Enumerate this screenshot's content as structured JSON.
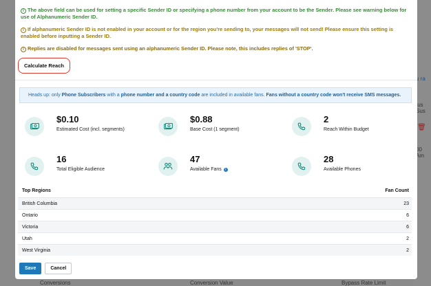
{
  "notes": [
    {
      "text": "The above field can be used for setting a specific Sender ID or specifying a phone number from your account to be the Sender. Please see warning below for use of Alphanumeric Sender ID.",
      "tone": "green"
    },
    {
      "text": "If alphanumeric Sender ID is not enabled in your account or for the region you're sending to, your messages will not send! Please ensure this setting is enabled before inputting a Sender ID.",
      "tone": "orange"
    },
    {
      "text": "Replies are disabled for messages sent using an alphanumeric Sender ID. Please note, this includes replies of 'STOP'.",
      "tone": "gold"
    }
  ],
  "calculate_button": "Calculate Reach",
  "banner": {
    "prefix": "Heads up: only ",
    "b1": "Phone Subscribers",
    "mid1": " with a ",
    "b2": "phone number and a country code",
    "mid2": " are included in available fans. ",
    "b3": "Fans without a country code won't receive SMS messages."
  },
  "stats": [
    {
      "value": "$0.10",
      "label": "Estimated Cost (incl. segments)",
      "icon": "money-icon"
    },
    {
      "value": "$0.88",
      "label": "Base Cost (1 segment)",
      "icon": "money-icon"
    },
    {
      "value": "2",
      "label": "Reach Within Budget",
      "icon": "phone-icon"
    },
    {
      "value": "16",
      "label": "Total Eligible Audience",
      "icon": "phone-icon"
    },
    {
      "value": "47",
      "label": "Available Fans",
      "icon": "people-icon"
    },
    {
      "value": "28",
      "label": "Available Phones",
      "icon": "phone-icon"
    }
  ],
  "regions": {
    "col_region": "Top Regions",
    "col_count": "Fan Count",
    "rows": [
      {
        "name": "British Columbia",
        "count": "23"
      },
      {
        "name": "Ontario",
        "count": "6"
      },
      {
        "name": "Victoria",
        "count": "6"
      },
      {
        "name": "Utah",
        "count": "2"
      },
      {
        "name": "West Virginia",
        "count": "2"
      }
    ]
  },
  "actions": {
    "save": "Save",
    "cancel": "Cancel"
  },
  "background": {
    "link": "u ra",
    "status": "tus Sus",
    "time": "00 Am",
    "footer_a": "Conversions",
    "footer_b": "Conversion Value",
    "footer_c": "Bypass Rate Limit"
  },
  "colors": {
    "accent": "#1f78b8",
    "teal": "#1a8c7e",
    "highlight": "#e03a2f"
  }
}
